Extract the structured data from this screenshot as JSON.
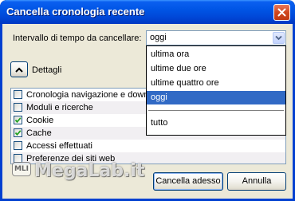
{
  "window": {
    "title": "Cancella cronologia recente"
  },
  "range": {
    "label": "Intervallo di tempo da cancellare:",
    "selected_value": "oggi",
    "options": [
      "ultima ora",
      "ultime due ore",
      "ultime quattro ore",
      "oggi",
      "tutto"
    ],
    "highlighted_option": "oggi"
  },
  "details": {
    "label": "Dettagli",
    "items": [
      {
        "label": "Cronologia navigazione e down",
        "checked": false
      },
      {
        "label": "Moduli e ricerche",
        "checked": false
      },
      {
        "label": "Cookie",
        "checked": true
      },
      {
        "label": "Cache",
        "checked": true
      },
      {
        "label": "Accessi effettuati",
        "checked": false
      },
      {
        "label": "Preferenze dei siti web",
        "checked": false
      }
    ]
  },
  "buttons": {
    "clear_label": "Cancella adesso",
    "cancel_label": "Annulla"
  },
  "watermark": {
    "badge": "MLI",
    "text": "MegaLab.it"
  },
  "colors": {
    "titlebar": "#0055e5",
    "selection": "#316ac5",
    "dialog_bg": "#ece9d8"
  },
  "icons": {
    "close": "close-icon",
    "dropdown": "chevron-down-icon",
    "details_toggle": "chevron-up-icon",
    "checkmark": "checkmark-icon"
  }
}
